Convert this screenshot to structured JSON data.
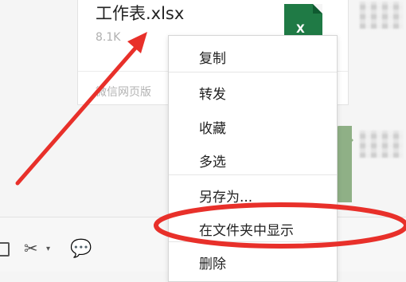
{
  "file_message": {
    "file_name": "工作表.xlsx",
    "file_size": "8.1K",
    "source": "微信网页版"
  },
  "file_icon": {
    "type": "excel-icon",
    "letter": "X",
    "color": "#1f7a45"
  },
  "context_menu": {
    "items": [
      {
        "label": "复制"
      },
      {
        "label": "转发"
      },
      {
        "label": "收藏"
      },
      {
        "label": "多选"
      },
      {
        "label": "另存为..."
      },
      {
        "label": "在文件夹中显示"
      },
      {
        "label": "删除"
      }
    ]
  },
  "toolbar": {
    "icons": [
      "folder-icon",
      "scissors-icon",
      "chevron-down-icon",
      "chat-bubble-icon"
    ]
  },
  "annotation": {
    "color": "#e8302a"
  }
}
